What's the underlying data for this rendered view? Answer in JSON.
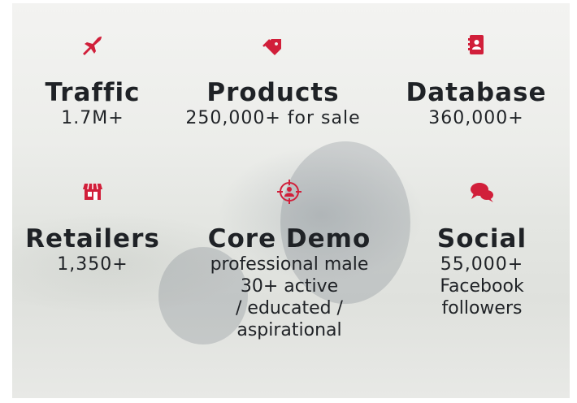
{
  "accent_color": "#d11f3a",
  "stats": [
    {
      "icon": "airplane-icon",
      "title": "Traffic",
      "value": "1.7M+"
    },
    {
      "icon": "price-tag-icon",
      "title": "Products",
      "value": "250,000+ for sale"
    },
    {
      "icon": "address-book-icon",
      "title": "Database",
      "value": "360,000+"
    },
    {
      "icon": "storefront-icon",
      "title": "Retailers",
      "value": "1,350+"
    },
    {
      "icon": "target-user-icon",
      "title": "Core Demo",
      "lines": [
        "professional male",
        "30+ active",
        "/ educated /",
        "aspirational"
      ]
    },
    {
      "icon": "chat-bubbles-icon",
      "title": "Social",
      "value": "55,000+",
      "lines": [
        "Facebook",
        "followers"
      ]
    }
  ]
}
